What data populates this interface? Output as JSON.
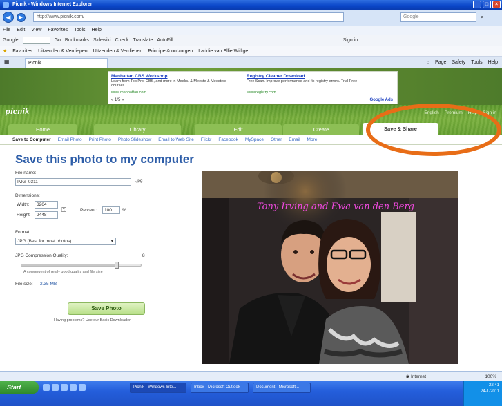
{
  "window": {
    "title": "Picnik - Windows Internet Explorer",
    "buttons": [
      "_",
      "□",
      "×"
    ]
  },
  "address": {
    "url": "http://www.picnik.com/",
    "search_placeholder": "Google"
  },
  "menubar": [
    "File",
    "Edit",
    "View",
    "Favorites",
    "Tools",
    "Help"
  ],
  "google_toolbar": {
    "label": "Google",
    "items": [
      "Go",
      "Bookmarks",
      "Sidewiki",
      "Check",
      "Translate",
      "AutoFill",
      "Sign in"
    ]
  },
  "favorites_bar": [
    "Favorites",
    "Uitzenden & Verdiepen",
    "Uitzenden & Verdiepen",
    "Principe & ontzorgen",
    "Laddie van Ellie Willige"
  ],
  "tab": {
    "label": "Picnik"
  },
  "command_bar": [
    "Page",
    "Safety",
    "Tools",
    "Help"
  ],
  "ads": {
    "items": [
      {
        "title": "Manhattan CBS Workshop",
        "text": "Learn from Top Pro: CBS, and more in Meeks. & Meeste & Meesters courses",
        "url": "www.manhattan.com"
      },
      {
        "title": "Registry Cleaner Download",
        "text": "Free Scan. Improve performance and fix registry errors. Trial Free",
        "url": "www.registry.com"
      }
    ],
    "nav": "« 1/5 »",
    "badge": "Google Ads"
  },
  "picnik": {
    "logo": "picnik",
    "top_links": [
      "English",
      "Premium",
      "Help",
      "Sign in"
    ],
    "tabs": [
      "Home",
      "Library",
      "Edit",
      "Create",
      "Save & Share"
    ],
    "subnav": [
      "Save to Computer",
      "Email Photo",
      "Print Photo",
      "Photo Slideshow",
      "Email to Web Site",
      "Flickr",
      "Facebook",
      "MySpace",
      "Other",
      "Email",
      "More"
    ]
  },
  "save_panel": {
    "title": "Save this photo to my computer",
    "file_name_label": "File name:",
    "file_name": "IMG_0311",
    "file_ext": ".jpg",
    "dimensions_label": "Dimensions:",
    "width_label": "Width:",
    "width": "3264",
    "height_label": "Height:",
    "height": "2448",
    "percent_label": "Percent:",
    "percent": "100",
    "percent_unit": "%",
    "format_label": "Format:",
    "format": "JPG (Best for most photos)",
    "quality_label": "JPG Compression Quality:",
    "quality_value": "8",
    "quality_fraction": 0.8,
    "quality_hint": "A convergent of really good quality and file size",
    "file_size_label": "File size:",
    "file_size": "2.35 MB",
    "save_button": "Save Photo",
    "trouble_text": "Having problems? Use our Basic Downloader"
  },
  "photo": {
    "caption": "Tony Irving and Ewa van den Berg"
  },
  "status": {
    "zone": "Internet",
    "zoom": "100%"
  },
  "taskbar": {
    "start": "Start",
    "tasks": [
      "Picnik - Windows Inte...",
      "Inbox - Microsoft Outlook",
      "Document - Microsoft..."
    ],
    "time": "22:41",
    "date": "24-1-2011"
  },
  "colors": {
    "picnik_green": "#7bb13e",
    "title_blue": "#2d5da8",
    "annotation_orange": "#e86d17",
    "caption_pink": "#f04adf"
  }
}
